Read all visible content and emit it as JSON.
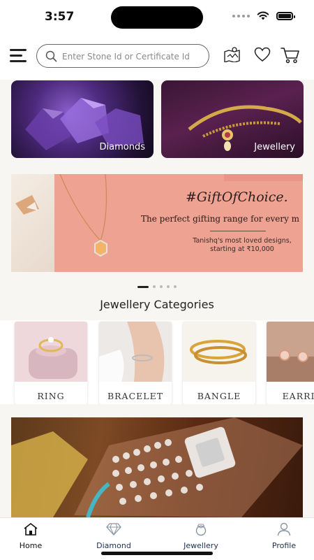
{
  "status_bar": {
    "time": "3:57"
  },
  "search": {
    "placeholder": "Enter Stone Id or Certificate Id"
  },
  "header_icons": [
    "map-icon",
    "heart-icon",
    "cart-icon"
  ],
  "tiles": [
    {
      "label": "Diamonds"
    },
    {
      "label": "Jewellery"
    }
  ],
  "banner": {
    "title": "#GiftOfChoice.",
    "subtitle": "The perfect gifting range for every m",
    "body_line1": "Tanishq's most loved designs,",
    "body_line2": "starting at ₹10,000"
  },
  "carousel": {
    "slides": 5,
    "active": 1
  },
  "section": {
    "title": "Jewellery Categories"
  },
  "categories": [
    {
      "label": "RING"
    },
    {
      "label": "BRACELET"
    },
    {
      "label": "BANGLE"
    },
    {
      "label": "EARRIN"
    }
  ],
  "bottom_nav": [
    {
      "label": "Home",
      "color": "#111111"
    },
    {
      "label": "Diamond",
      "color": "#1f2f4f"
    },
    {
      "label": "Jewellery",
      "color": "#1f2f4f"
    },
    {
      "label": "Profile",
      "color": "#1f2f4f"
    }
  ]
}
